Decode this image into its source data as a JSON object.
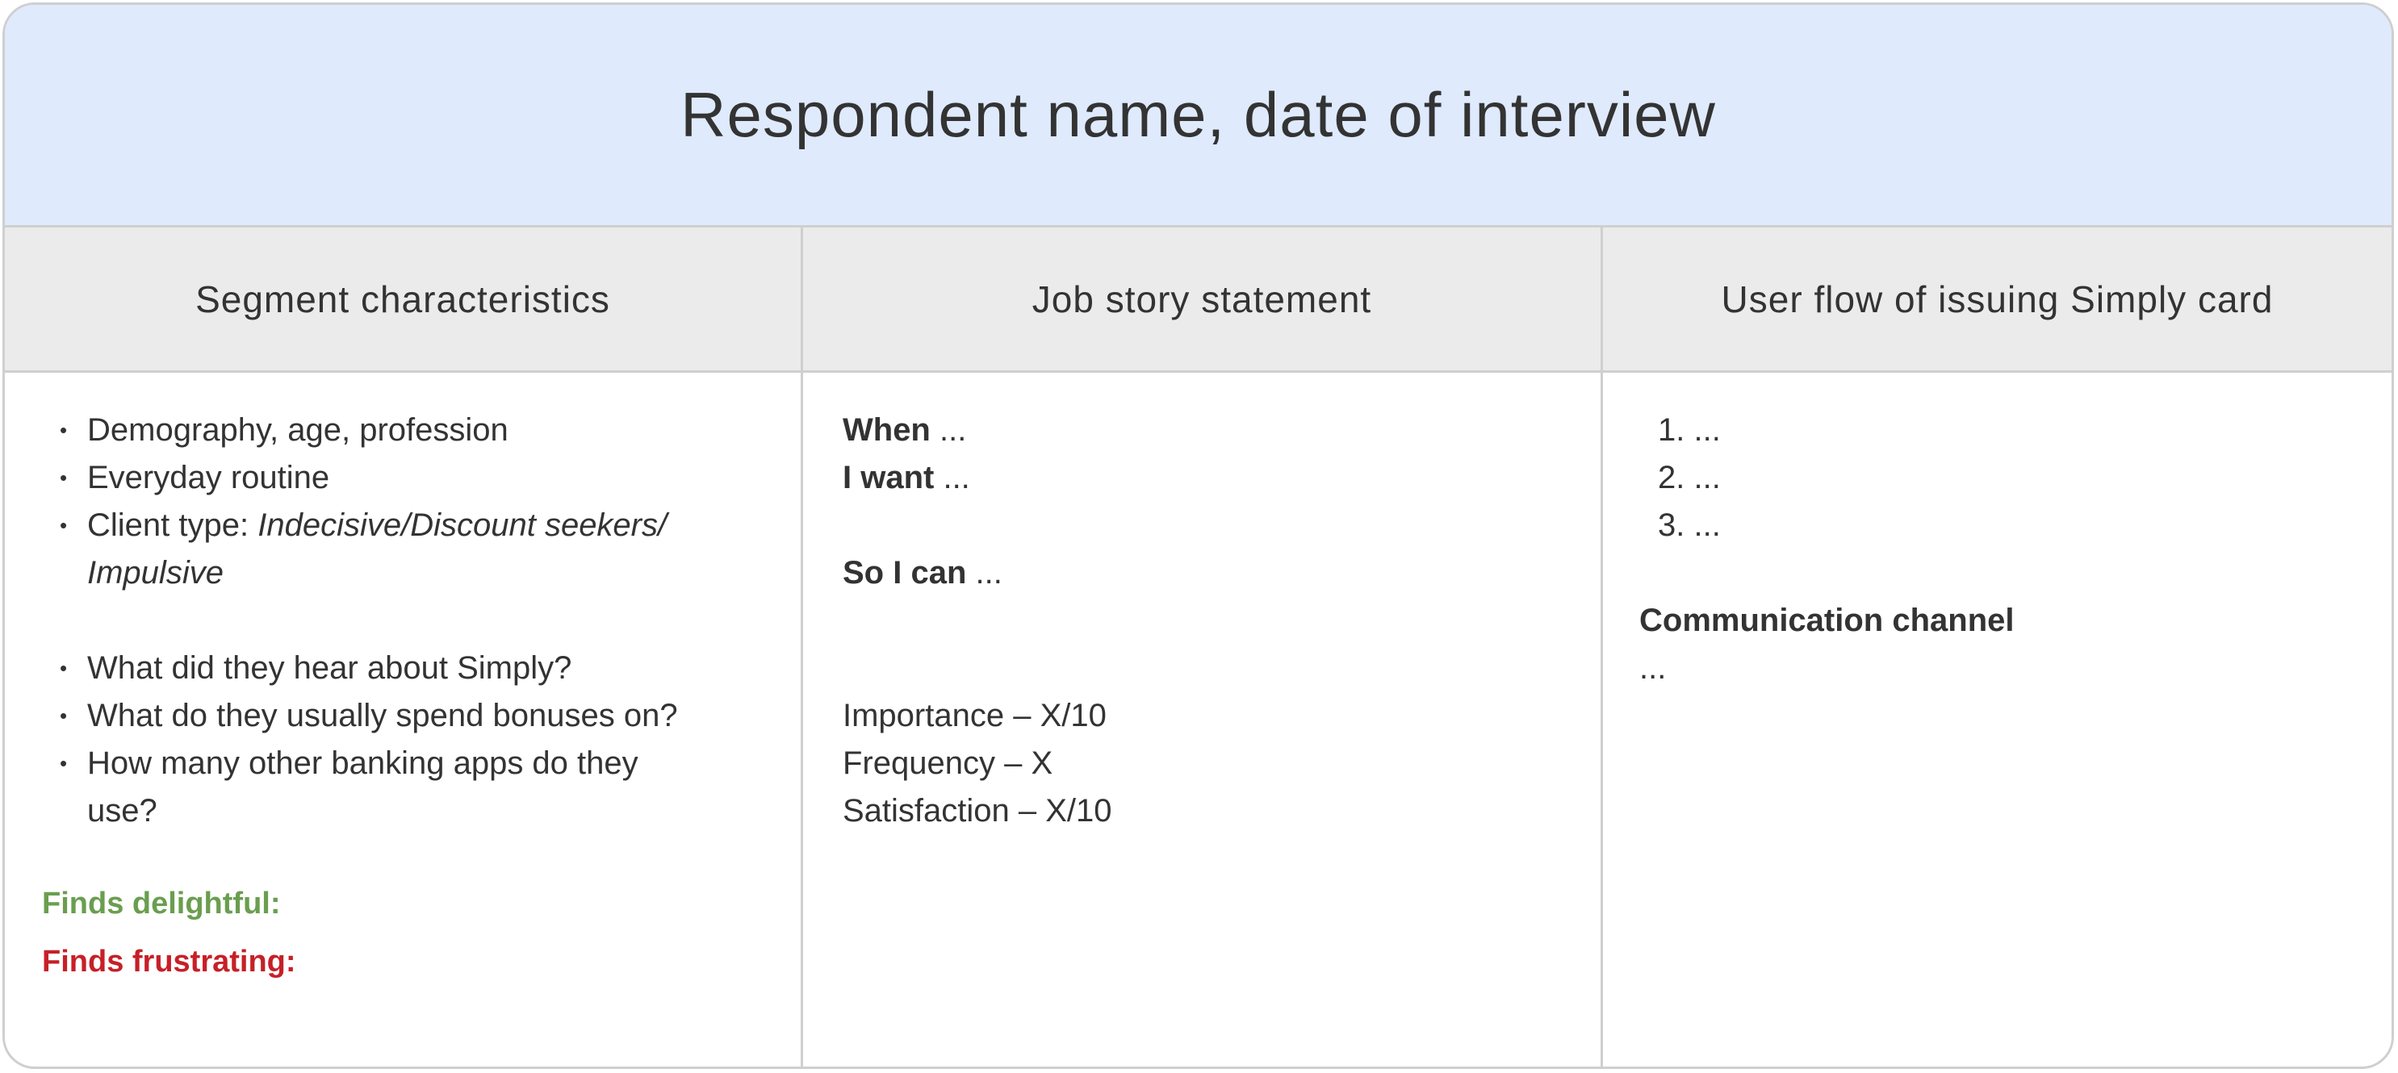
{
  "title": "Respondent name, date of interview",
  "columns": [
    {
      "header": "Segment characteristics"
    },
    {
      "header": "Job story statement"
    },
    {
      "header": "User flow of issuing Simply card"
    }
  ],
  "segment": {
    "items": [
      "Demography, age, profession",
      "Everyday routine"
    ],
    "client_type_label": "Client type: ",
    "client_type_value_1": "Indecisive/Discount seekers/",
    "client_type_value_2": "Impulsive",
    "questions": [
      "What did they hear about Simply?",
      "What do they usually spend bonuses on?",
      "How many other banking apps do they"
    ],
    "questions_cont": "use?",
    "delightful": "Finds delightful:",
    "frustrating": "Finds frustrating:",
    "delightful_color": "#6a9e4f",
    "frustrating_color": "#c62027"
  },
  "job_story": {
    "when": "When",
    "when_value": " ...",
    "want": "I want",
    "want_value": " ...",
    "so": "So I can",
    "so_value": " ...",
    "importance": "Importance – X/10",
    "frequency": "Frequency – X",
    "satisfaction": "Satisfaction – X/10"
  },
  "user_flow": {
    "steps": [
      "1. ...",
      "2. ...",
      "3. ..."
    ],
    "channel_label": "Communication channel",
    "channel_value": "..."
  }
}
